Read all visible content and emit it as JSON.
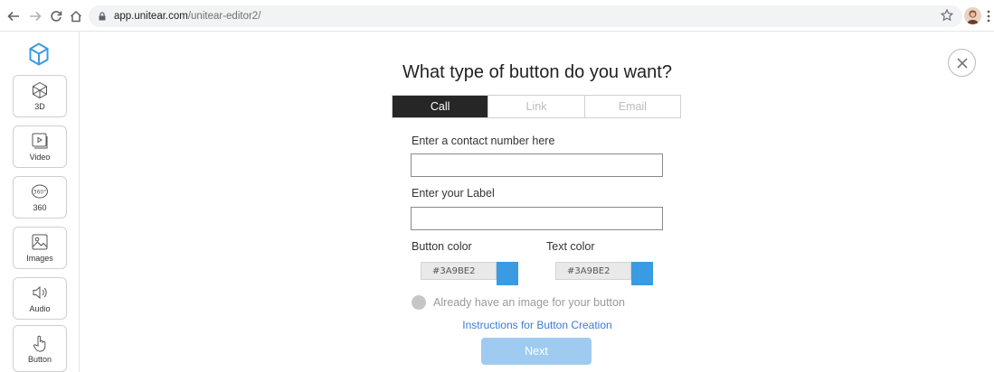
{
  "browser": {
    "url_host": "app.unitear.com",
    "url_path": "/unitear-editor2/"
  },
  "sidebar": {
    "items": [
      {
        "label": "3D",
        "icon": "cube-icon"
      },
      {
        "label": "Video",
        "icon": "video-icon"
      },
      {
        "label": "360",
        "icon": "panorama-360-icon"
      },
      {
        "label": "Images",
        "icon": "image-icon"
      },
      {
        "label": "Audio",
        "icon": "speaker-icon"
      },
      {
        "label": "Button",
        "icon": "pointer-hand-icon"
      }
    ]
  },
  "dialog": {
    "title": "What type of button do you want?",
    "tabs": [
      {
        "label": "Call",
        "active": true
      },
      {
        "label": "Link",
        "active": false
      },
      {
        "label": "Email",
        "active": false
      }
    ],
    "contact_label": "Enter a contact number here",
    "contact_value": "",
    "label_label": "Enter your Label",
    "label_value": "",
    "button_color_label": "Button color",
    "button_color_value": "#3A9BE2",
    "text_color_label": "Text color",
    "text_color_value": "#3A9BE2",
    "image_option": "Already have an image for your button",
    "instructions_link": "Instructions for Button Creation",
    "next_label": "Next"
  },
  "colors": {
    "accent": "#3A9BE2",
    "active_tab": "#262626",
    "next_button": "#9FCBF1",
    "link": "#3A7BD5"
  }
}
